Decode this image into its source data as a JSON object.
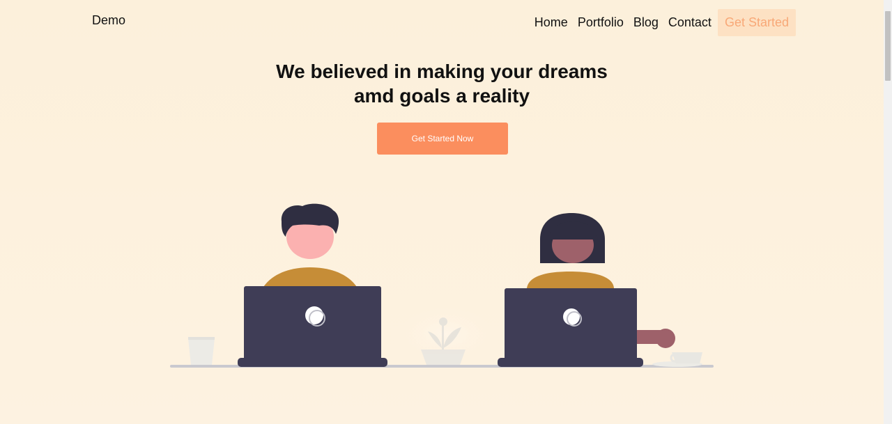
{
  "header": {
    "brand": "Demo",
    "nav": [
      {
        "label": "Home"
      },
      {
        "label": "Portfolio"
      },
      {
        "label": "Blog"
      },
      {
        "label": "Contact"
      }
    ],
    "cta_label": "Get Started"
  },
  "hero": {
    "title_line1": "We believed in making your dreams",
    "title_line2": "amd goals a reality",
    "button_label": "Get Started Now"
  },
  "colors": {
    "background": "#fdf1dd",
    "accent": "#fb8e5e",
    "cta_bg": "#fde1c3",
    "cta_text": "#f8a877",
    "laptop": "#3f3d56",
    "shirt": "#c68d37"
  },
  "illustration": {
    "name": "two-people-working-on-laptops"
  }
}
